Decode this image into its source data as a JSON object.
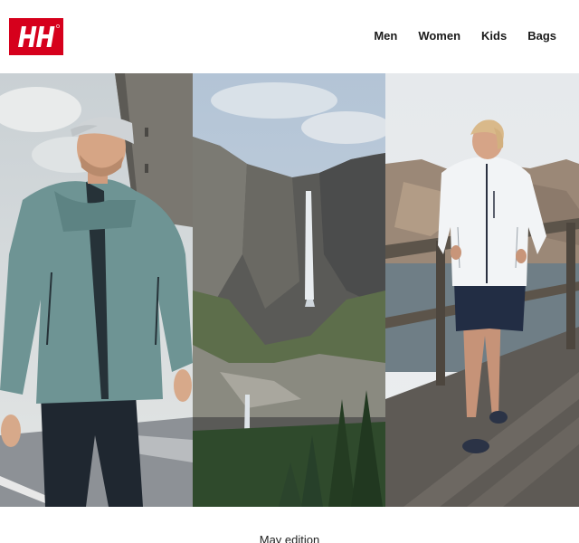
{
  "header": {
    "logo_text": "HH",
    "nav": [
      {
        "label": "Men"
      },
      {
        "label": "Women"
      },
      {
        "label": "Kids"
      },
      {
        "label": "Bags"
      }
    ]
  },
  "caption": {
    "text": "May edition"
  },
  "colors": {
    "brand_red": "#d6001c",
    "nav_text": "#1b1b1b"
  }
}
